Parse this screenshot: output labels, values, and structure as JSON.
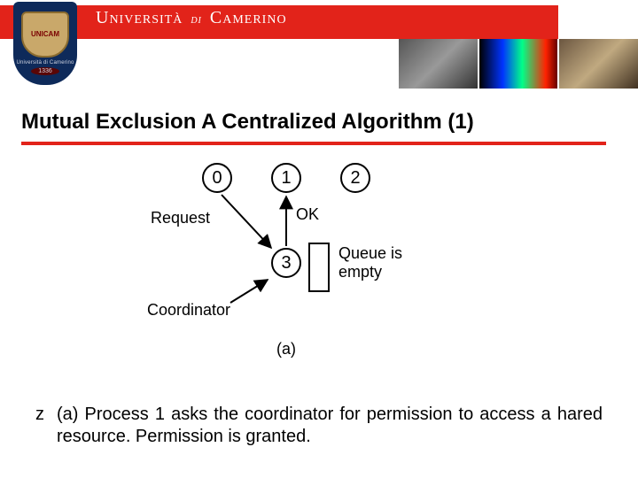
{
  "header": {
    "shield_main": "UNICAM",
    "shield_sub": "Università di Camerino",
    "shield_year": "1336",
    "university_a": "Università",
    "university_di": "di",
    "university_b": "Camerino"
  },
  "title": "Mutual Exclusion A Centralized Algorithm (1)",
  "diagram": {
    "nodes": {
      "n0": "0",
      "n1": "1",
      "n2": "2",
      "n3": "3"
    },
    "labels": {
      "request": "Request",
      "ok": "OK",
      "queue": "Queue is\nempty",
      "coordinator": "Coordinator"
    },
    "caption": "(a)"
  },
  "body": {
    "bullet": "z",
    "text": "(a) Process 1 asks the coordinator for permission to access a hared resource. Permission is granted."
  }
}
